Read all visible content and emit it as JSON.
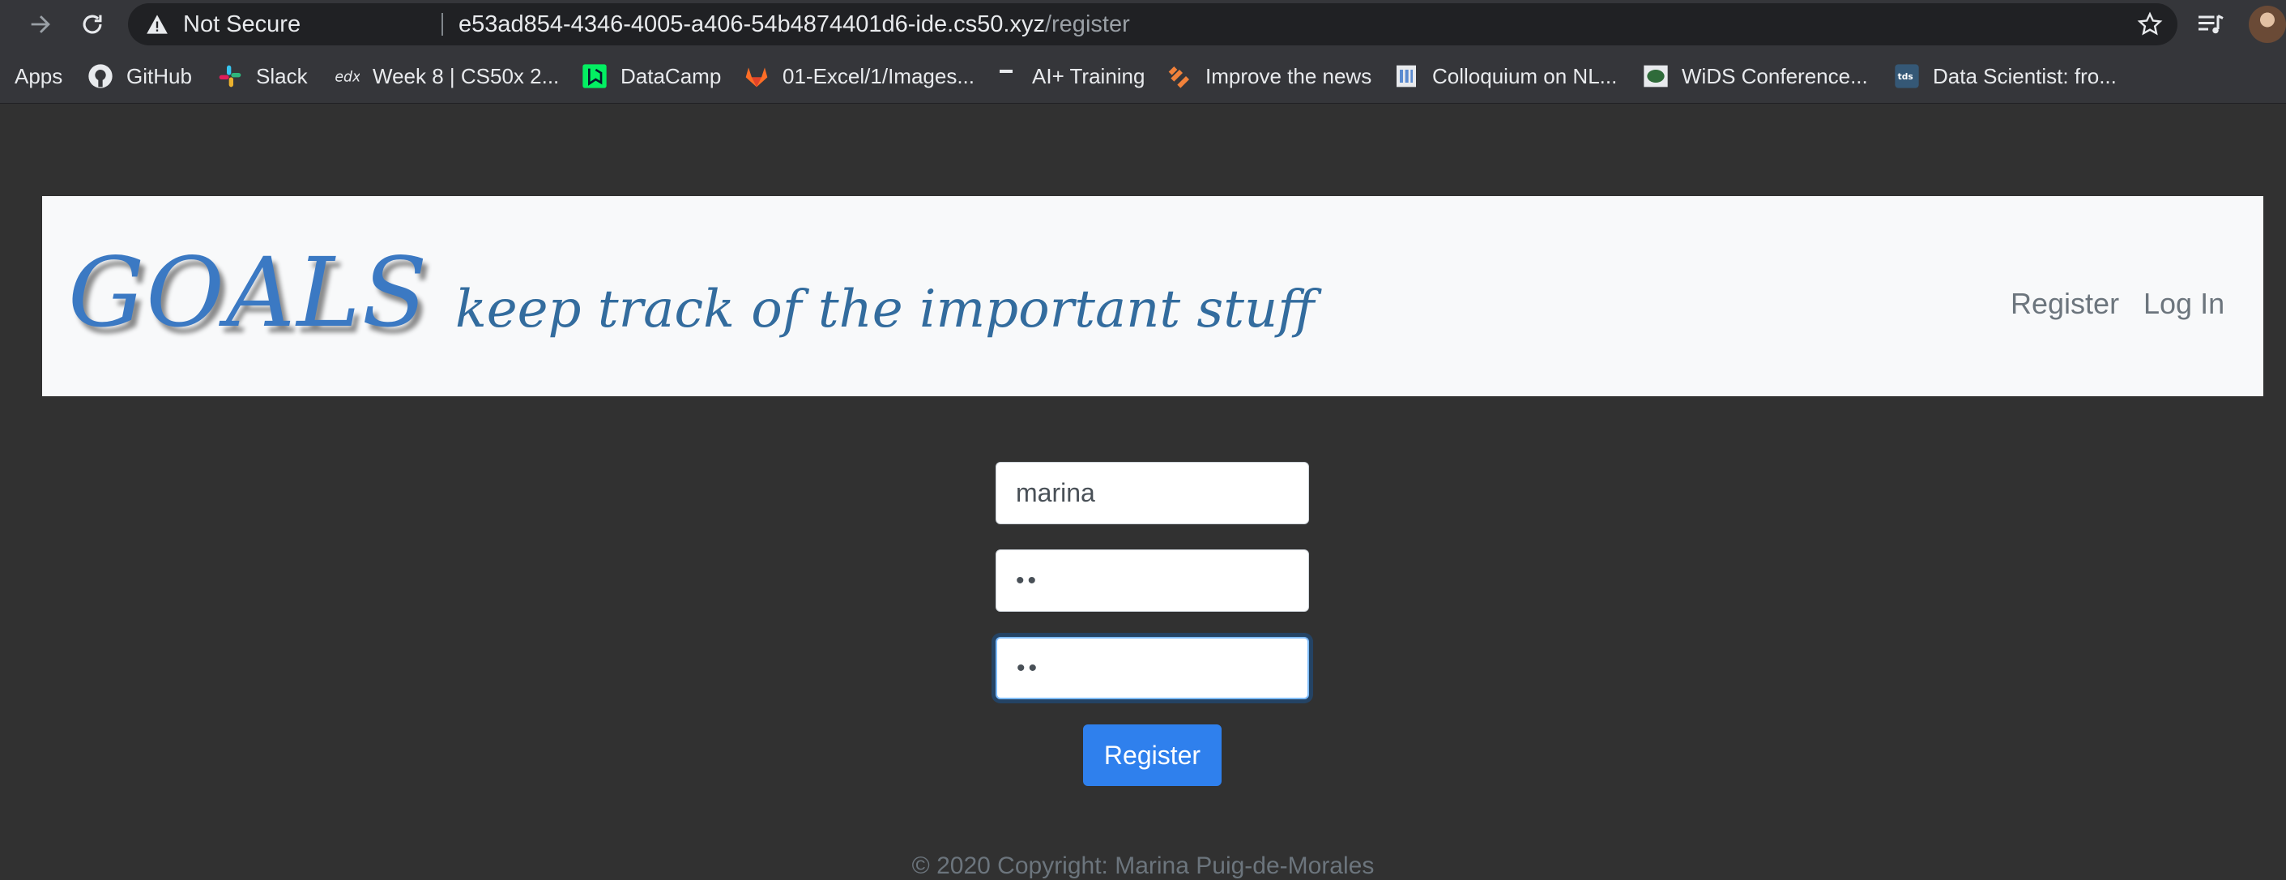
{
  "browser": {
    "security_label": "Not Secure",
    "url_host": "e53ad854-4346-4005-a406-54b4874401d6-ide.cs50.xyz",
    "url_path": "/register",
    "bookmarks": [
      {
        "label": "Apps",
        "icon": "apps-grid-icon"
      },
      {
        "label": "GitHub",
        "icon": "github-icon"
      },
      {
        "label": "Slack",
        "icon": "slack-icon"
      },
      {
        "label": "Week 8 | CS50x 2...",
        "icon": "edx-icon"
      },
      {
        "label": "DataCamp",
        "icon": "datacamp-icon"
      },
      {
        "label": "01-Excel/1/Images...",
        "icon": "gitlab-icon"
      },
      {
        "label": "AI+ Training",
        "icon": "ai-training-icon"
      },
      {
        "label": "Improve the news",
        "icon": "improve-news-icon"
      },
      {
        "label": "Colloquium on NL...",
        "icon": "colloquium-icon"
      },
      {
        "label": "WiDS Conference...",
        "icon": "wids-icon"
      },
      {
        "label": "Data Scientist: fro...",
        "icon": "tds-icon"
      }
    ]
  },
  "site": {
    "brand": "GOALS",
    "tagline": "keep track of the important stuff",
    "nav": {
      "register": "Register",
      "login": "Log In"
    }
  },
  "form": {
    "username_value": "marina",
    "password_value": "••",
    "confirmation_value": "••",
    "submit_label": "Register"
  },
  "footer": {
    "text": "© 2020 Copyright: Marina Puig-de-Morales"
  },
  "colors": {
    "page_bg": "#313131",
    "brand": "#3b79c3",
    "button": "#2f80ed",
    "navbar_bg": "#f8f9fa"
  }
}
